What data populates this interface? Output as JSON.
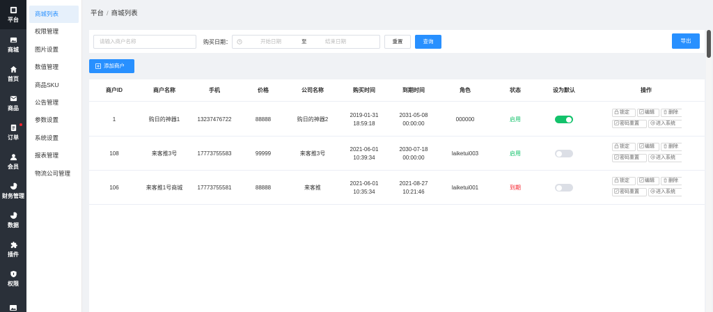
{
  "nav": {
    "items": [
      {
        "label": "平台",
        "icon": "platform-icon",
        "active": true
      },
      {
        "label": "商城",
        "icon": "image-icon"
      },
      {
        "label": "首页",
        "icon": "home-icon"
      },
      {
        "label": "商品",
        "icon": "mail-icon"
      },
      {
        "label": "订单",
        "icon": "order-icon",
        "badge": true
      },
      {
        "label": "会员",
        "icon": "user-icon"
      },
      {
        "label": "财务管理",
        "icon": "pie-icon"
      },
      {
        "label": "数据",
        "icon": "pie-icon"
      },
      {
        "label": "插件",
        "icon": "puzzle-icon"
      },
      {
        "label": "权限",
        "icon": "shield-icon"
      }
    ]
  },
  "submenu": {
    "items": [
      "商城列表",
      "权限管理",
      "图片设置",
      "数值管理",
      "商品SKU",
      "公告管理",
      "参数设置",
      "系统设置",
      "报表管理",
      "物流公司管理"
    ]
  },
  "breadcrumb": {
    "root": "平台",
    "sep": "/",
    "current": "商城列表"
  },
  "filter": {
    "merchant_placeholder": "请输入商户名称",
    "date_label": "购买日期：",
    "start_placeholder": "开始日期",
    "to": "至",
    "end_placeholder": "结束日期",
    "reset": "重置",
    "query": "查询",
    "export": "导出"
  },
  "add_button": "添加商户",
  "table": {
    "headers": [
      "商户ID",
      "商户名称",
      "手机",
      "价格",
      "公司名称",
      "购买时间",
      "到期时间",
      "角色",
      "状态",
      "设为默认",
      "操作"
    ],
    "rows": [
      {
        "id": "1",
        "name": "购日的神器1",
        "phone": "13237476722",
        "price": "88888",
        "company": "购日的神器2",
        "buy": "2019-01-31 18:59:18",
        "expire": "2031-05-08 00:00:00",
        "role": "000000",
        "status": "启用",
        "status_ok": true,
        "default": true
      },
      {
        "id": "108",
        "name": "来客推3号",
        "phone": "17773755583",
        "price": "99999",
        "company": "来客推3号",
        "buy": "2021-06-01 10:39:34",
        "expire": "2030-07-18 00:00:00",
        "role": "laiketui003",
        "status": "启用",
        "status_ok": true,
        "default": false
      },
      {
        "id": "106",
        "name": "来客推1号商城",
        "phone": "17773755581",
        "price": "88888",
        "company": "来客推",
        "buy": "2021-06-01 10:35:34",
        "expire": "2021-08-27 10:21:46",
        "role": "laiketui001",
        "status": "到期",
        "status_ok": false,
        "default": false
      }
    ],
    "ops": {
      "lock": "锁定",
      "edit": "编辑",
      "delete": "删除",
      "reset_pwd": "密码重置",
      "enter": "进入系统"
    }
  },
  "colors": {
    "accent": "#2890ff",
    "nav_bg": "#2a3039",
    "enabled": "#13c26b",
    "expired": "#f5222d"
  }
}
